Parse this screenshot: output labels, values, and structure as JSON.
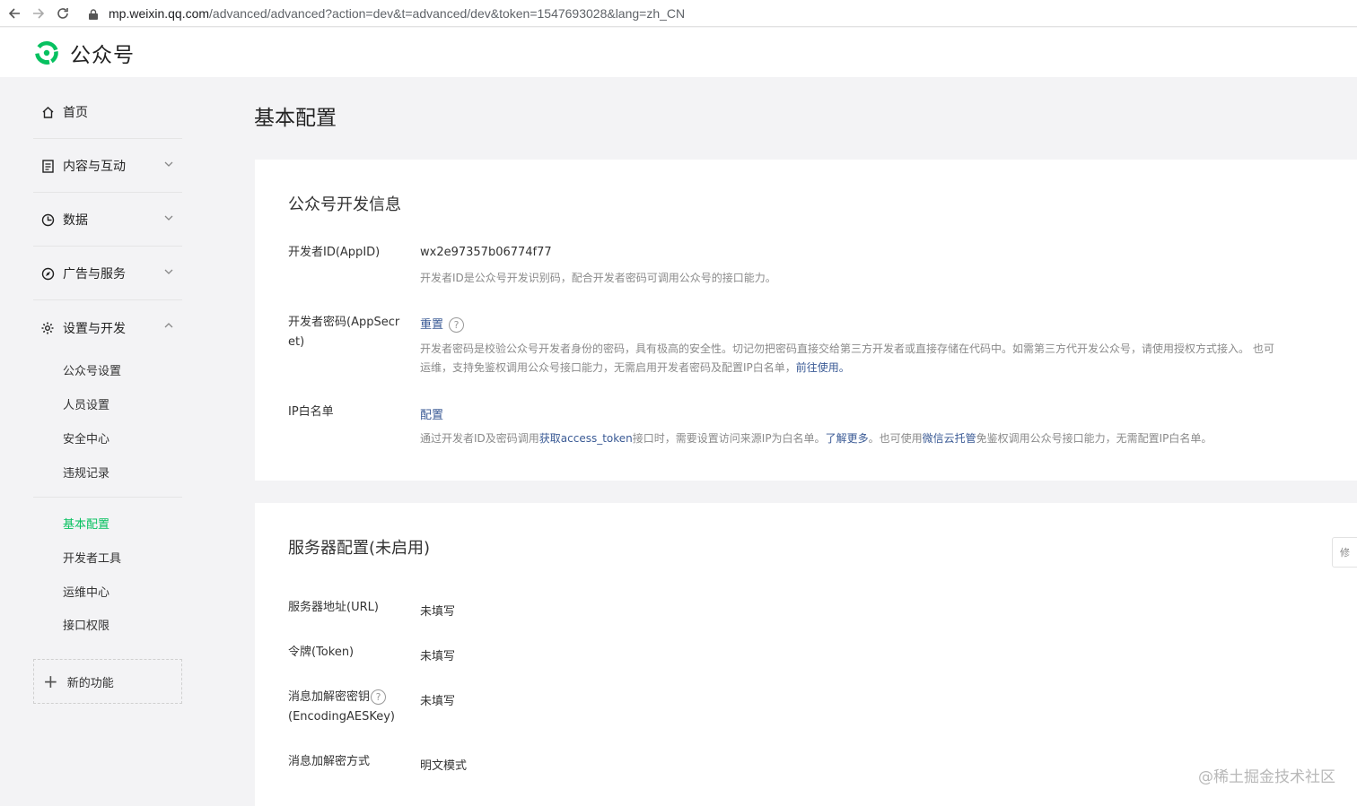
{
  "browser": {
    "url_host": "mp.weixin.qq.com",
    "url_path": "/advanced/advanced?action=dev&t=advanced/dev&token=1547693028&lang=zh_CN"
  },
  "header": {
    "site_name": "公众号"
  },
  "sidebar": {
    "items": [
      {
        "label": "首页",
        "icon": "home-icon"
      },
      {
        "label": "内容与互动",
        "icon": "document-icon"
      },
      {
        "label": "数据",
        "icon": "pie-chart-icon"
      },
      {
        "label": "广告与服务",
        "icon": "compass-icon"
      },
      {
        "label": "设置与开发",
        "icon": "gear-icon"
      }
    ],
    "settings_sub": [
      "公众号设置",
      "人员设置",
      "安全中心",
      "违规记录"
    ],
    "dev_sub": [
      "基本配置",
      "开发者工具",
      "运维中心",
      "接口权限"
    ],
    "active": "基本配置",
    "new_features": "新的功能"
  },
  "main": {
    "page_title": "基本配置",
    "dev_info": {
      "title": "公众号开发信息",
      "appid_label": "开发者ID(AppID)",
      "appid_value": "wx2e97357b06774f77",
      "appid_desc": "开发者ID是公众号开发识别码，配合开发者密码可调用公众号的接口能力。",
      "secret_label": "开发者密码(AppSecret)",
      "secret_action": "重置",
      "secret_desc_line1": "开发者密码是校验公众号开发者身份的密码，具有极高的安全性。切记勿把密码直接交给第三方开发者或直接存储在代码中。如需第三方代开发公众号，请使用授权方式接入。 也可",
      "secret_desc_line2": "运维，支持免鉴权调用公众号接口能力，无需启用开发者密码及配置IP白名单，",
      "secret_desc_link": "前往使用。",
      "ip_label": "IP白名单",
      "ip_action": "配置",
      "ip_desc_1": "通过开发者ID及密码调用",
      "ip_desc_link1": "获取access_token",
      "ip_desc_2": "接口时，需要设置访问来源IP为白名单。",
      "ip_desc_link2": "了解更多",
      "ip_desc_3": "。也可使用",
      "ip_desc_link3": "微信云托管",
      "ip_desc_4": "免鉴权调用公众号接口能力，无需配置IP白名单。"
    },
    "server": {
      "title": "服务器配置(未启用)",
      "url_label": "服务器地址(URL)",
      "url_value": "未填写",
      "token_label": "令牌(Token)",
      "token_value": "未填写",
      "aes_label_1": "消息加解密密钥",
      "aes_label_2": "(EncodingAESKey)",
      "aes_value": "未填写",
      "mode_label": "消息加解密方式",
      "mode_value": "明文模式",
      "side_tab": "修"
    }
  },
  "watermark": "@稀土掘金技术社区"
}
